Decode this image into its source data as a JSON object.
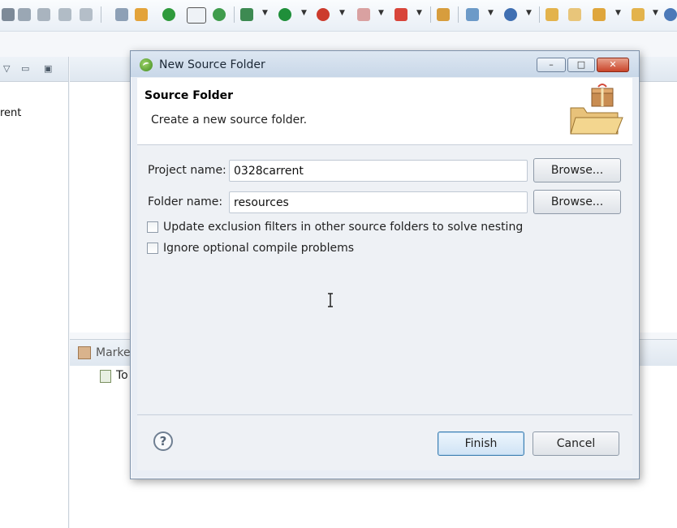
{
  "ide": {
    "left_tree_label": "rent",
    "markers_tab_label": "Marke",
    "task_row_label": "To"
  },
  "dialog": {
    "title": "New Source Folder",
    "header": {
      "title": "Source Folder",
      "description": "Create a new source folder."
    },
    "project_name": {
      "label": "Project name:",
      "value": "0328carrent",
      "browse_label": "Browse..."
    },
    "folder_name": {
      "label": "Folder name:",
      "value": "resources",
      "browse_label": "Browse..."
    },
    "options": [
      {
        "label": "Update exclusion filters in other source folders to solve nesting",
        "checked": false
      },
      {
        "label": "Ignore optional compile problems",
        "checked": false
      }
    ],
    "footer": {
      "help_glyph": "?",
      "finish_label": "Finish",
      "cancel_label": "Cancel"
    },
    "window_controls": {
      "minimize_glyph": "–",
      "maximize_glyph": "□",
      "close_glyph": "✕"
    }
  },
  "colors": {
    "title_bar": "#c8d7e8",
    "dialog_body": "#eef1f5",
    "close_button": "#c9452b",
    "default_button_border": "#3c7fb1"
  }
}
